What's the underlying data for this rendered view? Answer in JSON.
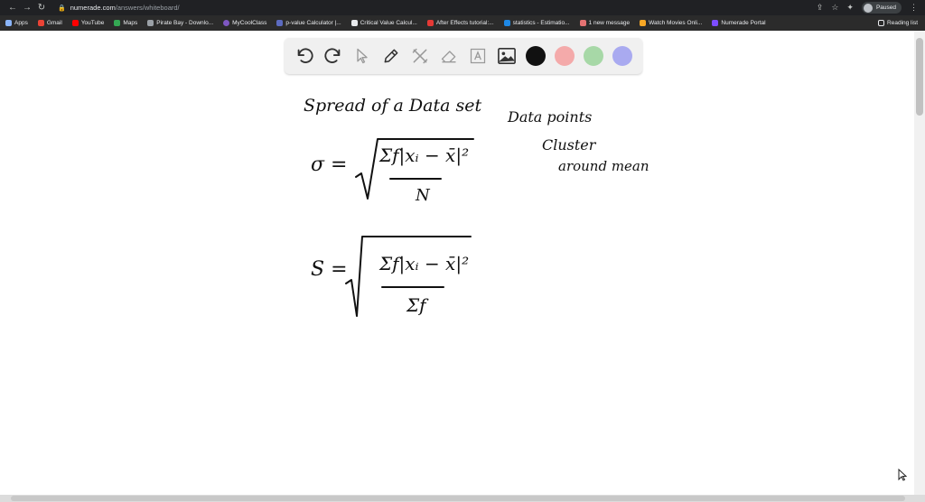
{
  "browser": {
    "url_host": "numerade.com",
    "url_path": "/answers/whiteboard/",
    "profile_status": "Paused"
  },
  "bookmarks": [
    {
      "label": "Apps",
      "color": "#8ab4f8"
    },
    {
      "label": "Gmail",
      "color": "#ea4335"
    },
    {
      "label": "YouTube",
      "color": "#ff0000"
    },
    {
      "label": "Maps",
      "color": "#34a853"
    },
    {
      "label": "Pirate Bay - Downlo...",
      "color": "#9aa0a6"
    },
    {
      "label": "MyCoolClass",
      "color": "#7e57c2"
    },
    {
      "label": "p-value Calculator |...",
      "color": "#5c6bc0"
    },
    {
      "label": "Critical Value Calcul...",
      "color": "#e8eaed"
    },
    {
      "label": "After Effects tutorial:...",
      "color": "#e53935"
    },
    {
      "label": "statistics - Estimatio...",
      "color": "#1e88e5"
    },
    {
      "label": "1 new message",
      "color": "#e57373"
    },
    {
      "label": "Watch Movies Onli...",
      "color": "#f9a825"
    },
    {
      "label": "Numerade Portal",
      "color": "#7c4dff"
    }
  ],
  "reading_list": "Reading list",
  "toolbar": {
    "tools": [
      "undo-icon",
      "redo-icon",
      "pointer-icon",
      "pen-icon",
      "tools-icon",
      "eraser-icon",
      "text-icon",
      "image-icon"
    ],
    "colors": [
      "#111111",
      "#f4aaaa",
      "#a7d8a7",
      "#a9aaf0"
    ]
  },
  "board": {
    "heading": "Spread of a Data set",
    "note_line1": "Data points",
    "note_line2": "Cluster",
    "note_line3": "around mean",
    "formula1_lhs": "σ =",
    "formula1_num": "Σf|xᵢ − x̄|²",
    "formula1_den": "N",
    "formula2_lhs": "S =",
    "formula2_num": "Σf|xᵢ − x̄|²",
    "formula2_den": "Σf"
  }
}
